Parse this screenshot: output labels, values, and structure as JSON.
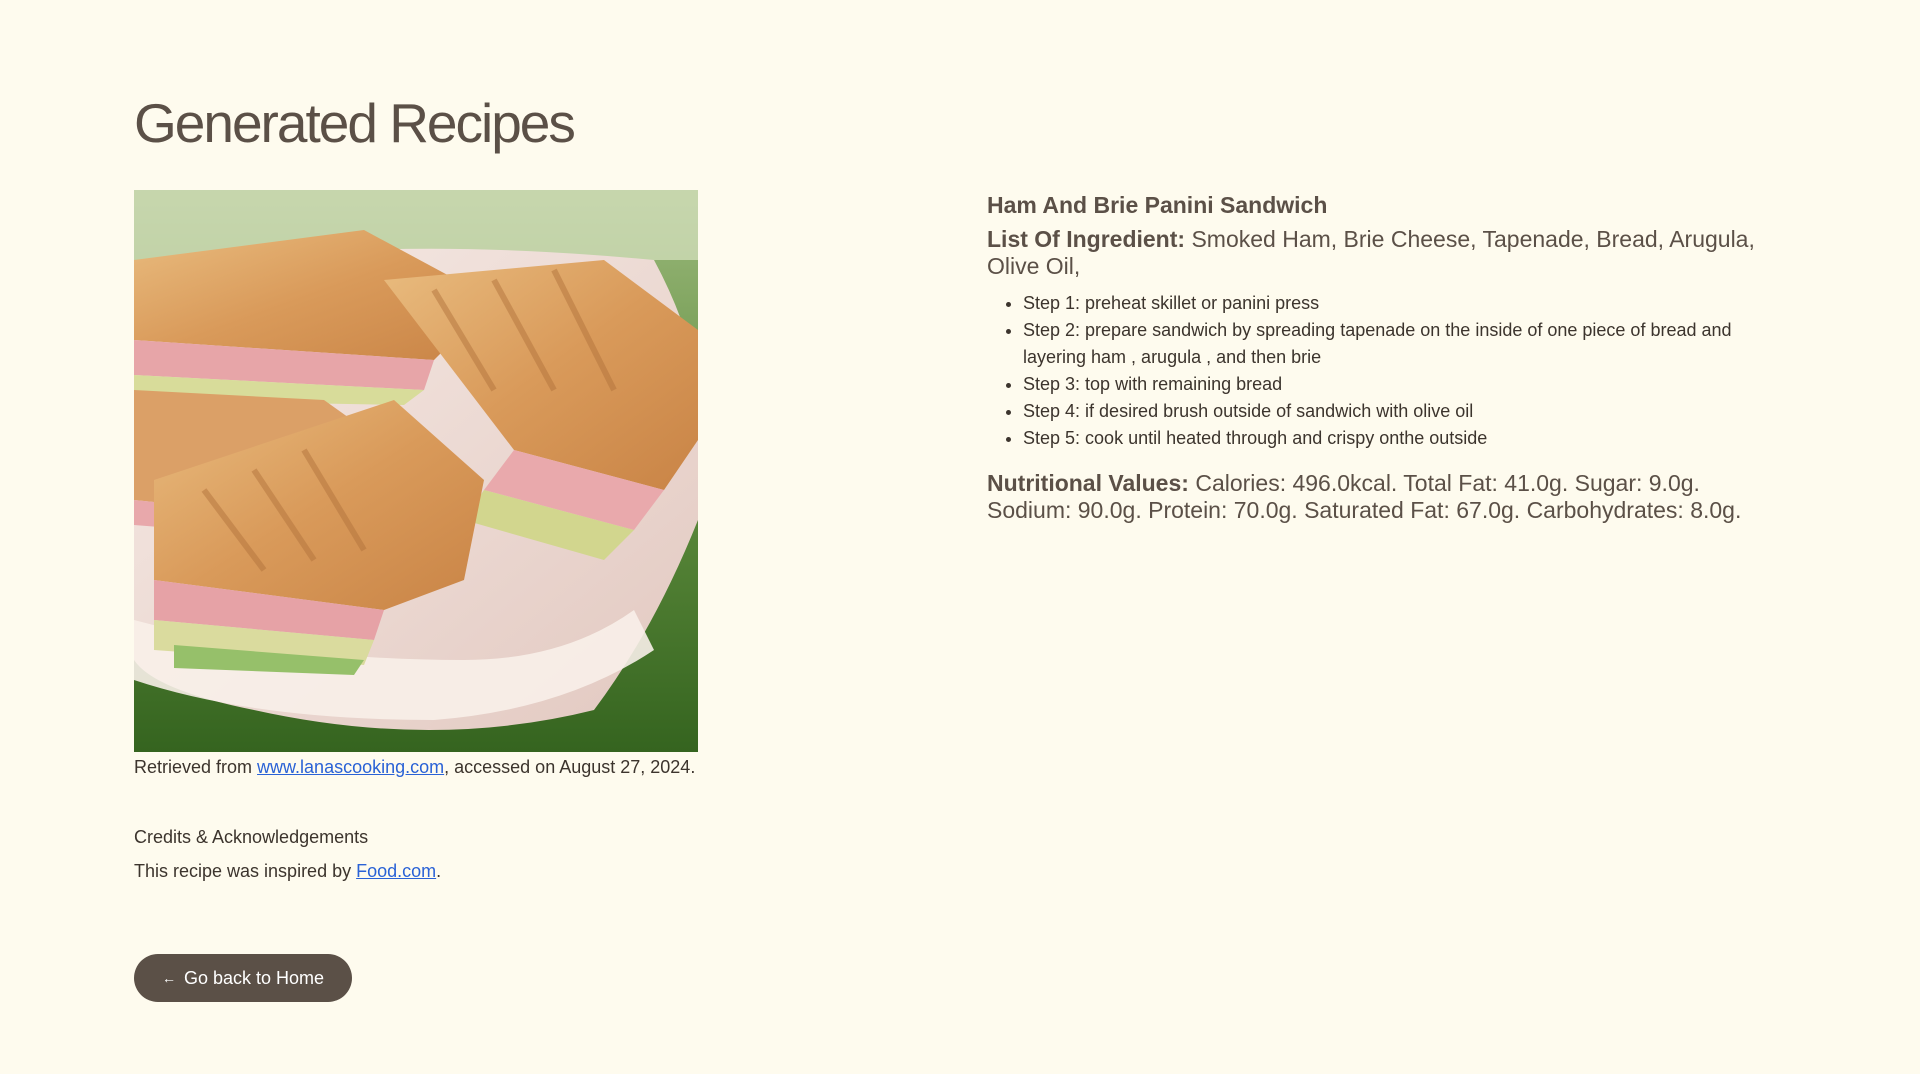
{
  "page": {
    "title": "Generated Recipes"
  },
  "image_credit": {
    "prefix": "Retrieved from ",
    "link_text": "www.lanascooking.com",
    "suffix": ", accessed on August 27, 2024."
  },
  "credits": {
    "heading": "Credits & Acknowledgements",
    "prefix": "This recipe was inspired by ",
    "link_text": "Food.com",
    "suffix": "."
  },
  "recipe": {
    "name": "Ham And Brie Panini Sandwich",
    "ingredients_label": "List Of Ingredient:",
    "ingredients_text": " Smoked Ham, Brie Cheese, Tapenade, Bread, Arugula, Olive Oil,",
    "steps": [
      "Step 1: preheat skillet or panini press",
      "Step 2: prepare sandwich by spreading tapenade on the inside of one piece of bread and layering ham , arugula , and then brie",
      "Step 3: top with remaining bread",
      "Step 4: if desired brush outside of sandwich with olive oil",
      "Step 5: cook until heated through and crispy onthe outside"
    ],
    "nutrition_label": "Nutritional Values:",
    "nutrition_text": " Calories: 496.0kcal. Total Fat: 41.0g. Sugar: 9.0g. Sodium: 90.0g. Protein: 70.0g. Saturated Fat: 67.0g. Carbohydrates: 8.0g."
  },
  "back_button": {
    "icon": "arrow-left-icon",
    "label": "Go back to Home"
  },
  "colors": {
    "background": "#fefbee",
    "text": "#5b5047",
    "button_bg": "#5b5047",
    "link": "#2a62d6"
  }
}
